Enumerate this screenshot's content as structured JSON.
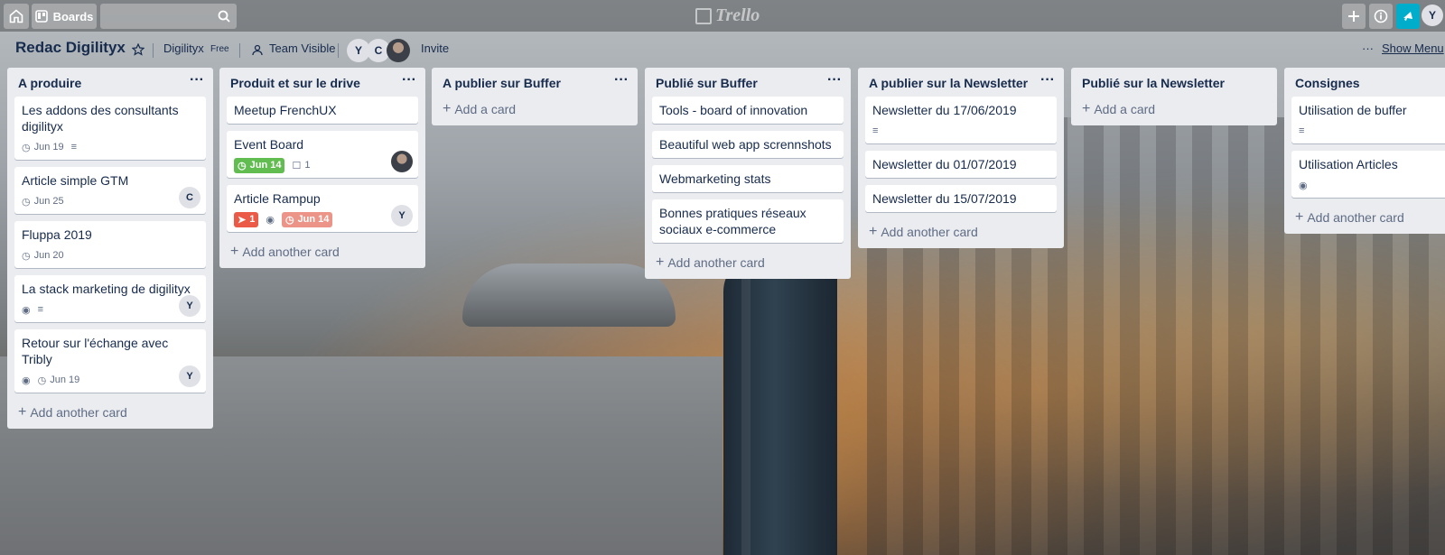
{
  "header": {
    "boards_label": "Boards",
    "search_placeholder": "",
    "logo_text": "Trello",
    "user_initial": "Y"
  },
  "board": {
    "title": "Redac Digilityx",
    "team_name": "Digilityx",
    "plan": "Free",
    "visibility": "Team Visible",
    "members": [
      "Y",
      "C"
    ],
    "invite_label": "Invite",
    "show_menu_label": "Show Menu"
  },
  "lists": [
    {
      "title": "A produire",
      "add_label": "Add another card",
      "cards": [
        {
          "title": "Les addons des consultants digilityx",
          "due": "Jun 19",
          "description": true
        },
        {
          "title": "Article simple GTM",
          "due": "Jun 25",
          "member": "C"
        },
        {
          "title": "Fluppa 2019",
          "due": "Jun 20"
        },
        {
          "title": "La stack marketing de digilityx",
          "watch": true,
          "description": true,
          "member": "Y"
        },
        {
          "title": "Retour sur l'échange avec Tribly",
          "watch": true,
          "due": "Jun 19",
          "member": "Y"
        }
      ]
    },
    {
      "title": "Produit et sur le drive",
      "add_label": "Add another card",
      "cards": [
        {
          "title": "Meetup FrenchUX"
        },
        {
          "title": "Event Board",
          "due_complete": "Jun 14",
          "comments": "1",
          "member_photo": true
        },
        {
          "title": "Article Rampup",
          "priority_count": "1",
          "watch": true,
          "due_overdue": "Jun 14",
          "member": "Y"
        }
      ]
    },
    {
      "title": "A publier sur Buffer",
      "add_label": "Add a card",
      "cards": []
    },
    {
      "title": "Publié sur Buffer",
      "add_label": "Add another card",
      "cards": [
        {
          "title": "Tools - board of innovation"
        },
        {
          "title": "Beautiful web app scrennshots"
        },
        {
          "title": "Webmarketing stats"
        },
        {
          "title": "Bonnes pratiques réseaux sociaux e-commerce"
        }
      ]
    },
    {
      "title": "A publier sur la Newsletter",
      "add_label": "Add another card",
      "cards": [
        {
          "title": "Newsletter du 17/06/2019",
          "description": true
        },
        {
          "title": "Newsletter du 01/07/2019"
        },
        {
          "title": "Newsletter du 15/07/2019"
        }
      ]
    },
    {
      "title": "Publié sur la Newsletter",
      "add_label": "Add a card",
      "cards": []
    },
    {
      "title": "Consignes",
      "add_label": "Add another card",
      "cards": [
        {
          "title": "Utilisation de buffer",
          "description": true
        },
        {
          "title": "Utilisation Articles",
          "watch": true
        }
      ]
    }
  ],
  "colors": {
    "list_bg": "#ebecf0",
    "due_complete": "#61bd4f",
    "due_overdue": "#eb5a46",
    "accent_cyan": "#00aecc"
  }
}
